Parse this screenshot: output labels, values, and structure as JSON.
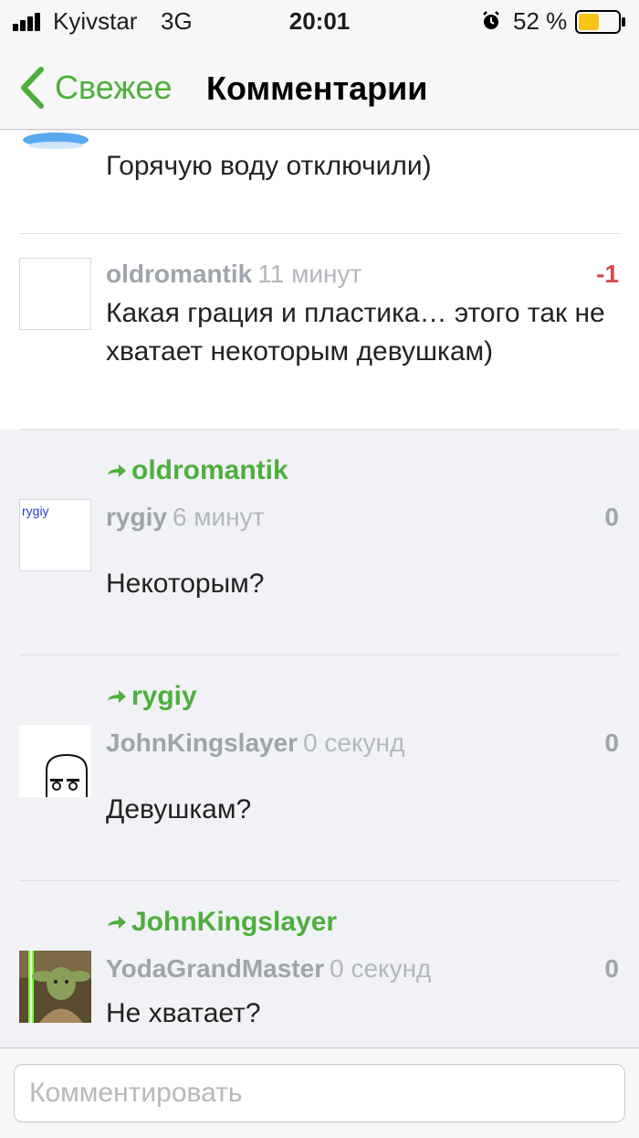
{
  "status_bar": {
    "carrier": "Kyivstar",
    "network": "3G",
    "time": "20:01",
    "battery": "52 %",
    "battery_level": 0.52,
    "battery_color": "#f5c518"
  },
  "nav": {
    "back_label": "Свежее",
    "title": "Комментарии",
    "accent_color": "#4eae3d"
  },
  "comments": [
    {
      "text": "Горячую воду отключили)"
    },
    {
      "author": "oldromantik",
      "time": "11 минут",
      "score": "-1",
      "text": "Какая грация и пластика… этого так не хватает некоторым девушкам)"
    },
    {
      "reply_to": "oldromantik",
      "author": "rygiy",
      "avatar_text": "rygiy",
      "time": "6 минут",
      "score": "0",
      "text": "Некоторым?"
    },
    {
      "reply_to": "rygiy",
      "author": "JohnKingslayer",
      "time": "0 секунд",
      "score": "0",
      "text": "Девушкам?"
    },
    {
      "reply_to": "JohnKingslayer",
      "author": "YodaGrandMaster",
      "time": "0 секунд",
      "score": "0",
      "text": "Не хватает?"
    }
  ],
  "composer": {
    "placeholder": "Комментировать"
  }
}
